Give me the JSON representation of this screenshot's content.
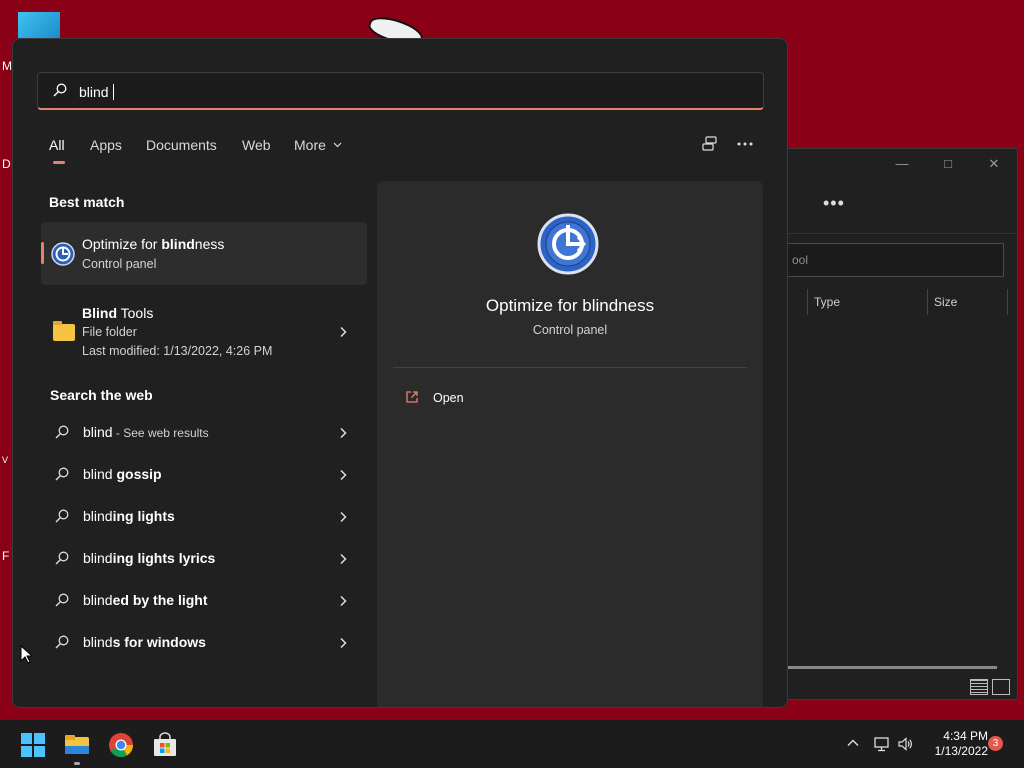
{
  "desktop": {
    "letters": [
      "M",
      "D",
      "V",
      "F"
    ]
  },
  "explorer": {
    "search_fragment": "ool",
    "columns": {
      "type": "Type",
      "size": "Size"
    }
  },
  "search": {
    "query": "blind"
  },
  "tabs": [
    "All",
    "Apps",
    "Documents",
    "Web",
    "More"
  ],
  "sections": {
    "best_match": "Best match",
    "search_web": "Search the web"
  },
  "best_match": {
    "title_bold": "blind",
    "title_prefix": "Optimize for ",
    "title_suffix": "ness",
    "subtitle": "Control panel"
  },
  "folder_result": {
    "title_bold": "Blind",
    "title_suffix": " Tools",
    "type": "File folder",
    "modified": "Last modified: 1/13/2022, 4:26 PM"
  },
  "web_results": [
    {
      "plain": "blind",
      "rest": "",
      "sub": " - See web results"
    },
    {
      "plain": "blind",
      "rest": " gossip",
      "sub": ""
    },
    {
      "plain": "blind",
      "rest": "ing lights",
      "sub": ""
    },
    {
      "plain": "blind",
      "rest": "ing lights lyrics",
      "sub": ""
    },
    {
      "plain": "blind",
      "rest": "ed by the light",
      "sub": ""
    },
    {
      "plain": "blind",
      "rest": "s for windows",
      "sub": ""
    }
  ],
  "preview": {
    "title": "Optimize for blindness",
    "subtitle": "Control panel",
    "action": "Open"
  },
  "taskbar": {
    "time": "4:34 PM",
    "date": "1/13/2022",
    "notification_count": "3"
  },
  "colors": {
    "accent": "#e5826a",
    "desktop_bg": "#8a0017",
    "panel_bg": "#202020"
  }
}
